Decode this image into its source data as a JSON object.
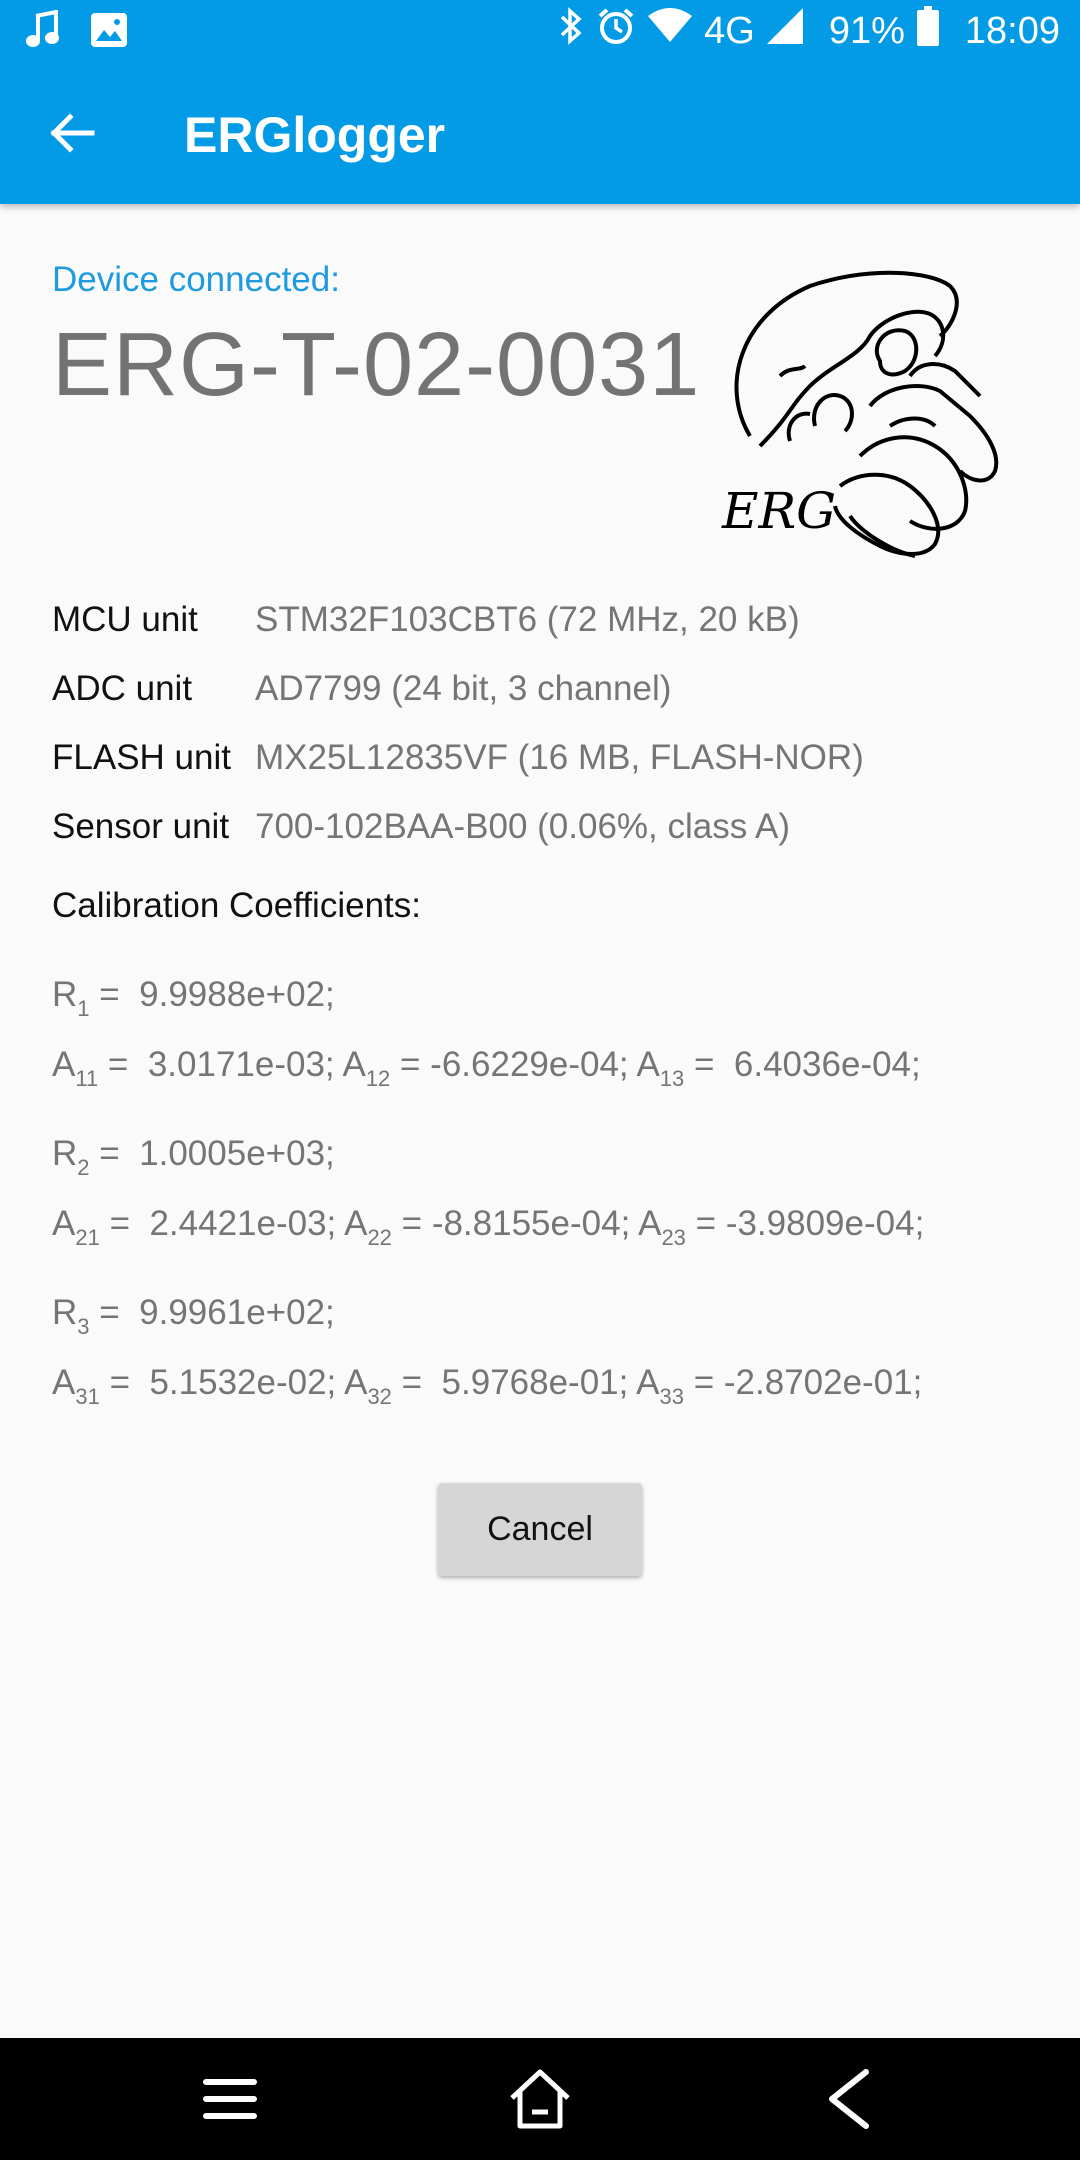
{
  "status_bar": {
    "battery": "91%",
    "time": "18:09",
    "network": "4G",
    "icons": [
      "music-note-icon",
      "image-icon",
      "bluetooth-icon",
      "alarm-icon",
      "wifi-icon",
      "signal-icon",
      "battery-icon"
    ]
  },
  "toolbar": {
    "title": "ERGlogger",
    "back_icon": "arrow-back-icon"
  },
  "device": {
    "label": "Device connected:",
    "name": "ERG-T-02-0031",
    "logo_text": "ERG"
  },
  "units": [
    {
      "label": "MCU unit",
      "value": "STM32F103CBT6 (72 MHz, 20 kB)"
    },
    {
      "label": "ADC unit",
      "value": "AD7799 (24 bit, 3 channel)"
    },
    {
      "label": "FLASH unit",
      "value": "MX25L12835VF (16 MB, FLASH-NOR)"
    },
    {
      "label": "Sensor unit",
      "value": "700-102BAA-B00 (0.06%, class A)"
    }
  ],
  "calibration": {
    "title": "Calibration Coefficients:",
    "channels": [
      {
        "r_sym": "R",
        "r_sub": "1",
        "r_val": "9.9988e+02;",
        "a": [
          {
            "sub": "11",
            "val": " 3.0171e-03;"
          },
          {
            "sub": "12",
            "val": "-6.6229e-04;"
          },
          {
            "sub": "13",
            "val": " 6.4036e-04;"
          }
        ]
      },
      {
        "r_sym": "R",
        "r_sub": "2",
        "r_val": "1.0005e+03;",
        "a": [
          {
            "sub": "21",
            "val": " 2.4421e-03;"
          },
          {
            "sub": "22",
            "val": "-8.8155e-04;"
          },
          {
            "sub": "23",
            "val": "-3.9809e-04;"
          }
        ]
      },
      {
        "r_sym": "R",
        "r_sub": "3",
        "r_val": "9.9961e+02;",
        "a": [
          {
            "sub": "31",
            "val": " 5.1532e-02;"
          },
          {
            "sub": "32",
            "val": " 5.9768e-01;"
          },
          {
            "sub": "33",
            "val": "-2.8702e-01;"
          }
        ]
      }
    ]
  },
  "actions": {
    "cancel_label": "Cancel"
  },
  "nav_bar": {
    "icons": [
      "menu-icon",
      "home-icon",
      "back-triangle-icon"
    ]
  },
  "colors": {
    "primary": "#039BE5",
    "accent_text": "#1E9AE0",
    "secondary_text": "#757575"
  }
}
